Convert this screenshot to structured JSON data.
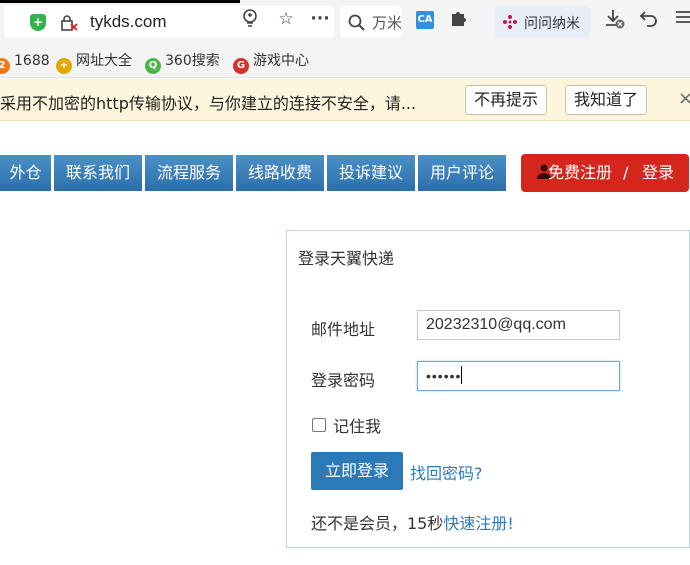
{
  "browser": {
    "url": "tykds.com",
    "search_placeholder": "万米",
    "ext_ca_label": "CA",
    "ext_nami_label": "问问纳米",
    "shield_glyph": "+",
    "icons": [
      "shield-icon",
      "insecure-lock-icon",
      "lightbulb-icon",
      "star-icon",
      "more-icon",
      "search-icon",
      "translate-icon",
      "puzzle-icon",
      "download-icon",
      "undo-icon",
      "menu-icon"
    ]
  },
  "bookmarks": [
    {
      "label": "1688",
      "badge": "2",
      "color": "#f07a1a"
    },
    {
      "label": "网址大全",
      "badge": "+",
      "color": "#e5a800"
    },
    {
      "label": "360搜索",
      "badge": "Q",
      "color": "#4cb748"
    },
    {
      "label": "游戏中心",
      "badge": "G",
      "color": "#d8302a"
    }
  ],
  "warning": {
    "message": "采用不加密的http传输协议，与你建立的连接不安全，请...",
    "dismiss_label": "不再提示",
    "ack_label": "我知道了",
    "close_glyph": "×"
  },
  "nav": {
    "items": [
      "外仓",
      "联系我们",
      "流程服务",
      "线路收费",
      "投诉建议",
      "用户评论"
    ],
    "register_label": "免费注册",
    "separator": "/",
    "login_label": "登录"
  },
  "login": {
    "title": "登录天翼快递",
    "email_label": "邮件地址",
    "email_value": "20232310@qq.com",
    "password_label": "登录密码",
    "password_mask": "••••••",
    "remember_label": "记住我",
    "submit_label": "立即登录",
    "forgot_label": "找回密码?",
    "register_prompt": "还不是会员，15秒",
    "register_link": "快速注册",
    "register_suffix": "!"
  },
  "colors": {
    "nav_blue": "#2c6ea9",
    "register_red": "#d4261d",
    "link_blue": "#2a7ec0",
    "warning_bg": "#fdf6dc"
  }
}
